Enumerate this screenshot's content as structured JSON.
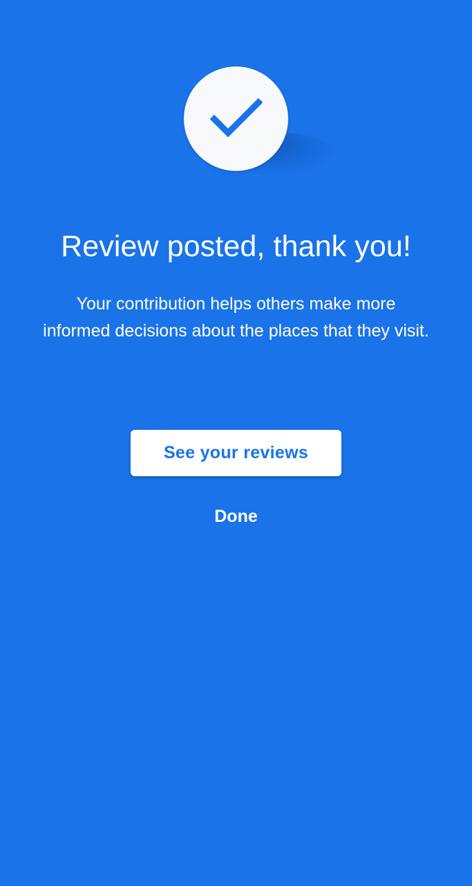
{
  "screen": {
    "background_color": "#1a73e8"
  },
  "confirmation": {
    "icon": "checkmark-icon",
    "icon_color": "#1a73e8",
    "badge_color": "#f8f9fb",
    "title": "Review posted, thank you!",
    "message": "Your contribution helps others make more informed decisions about the places that they visit."
  },
  "actions": {
    "primary_label": "See your reviews",
    "secondary_label": "Done"
  }
}
